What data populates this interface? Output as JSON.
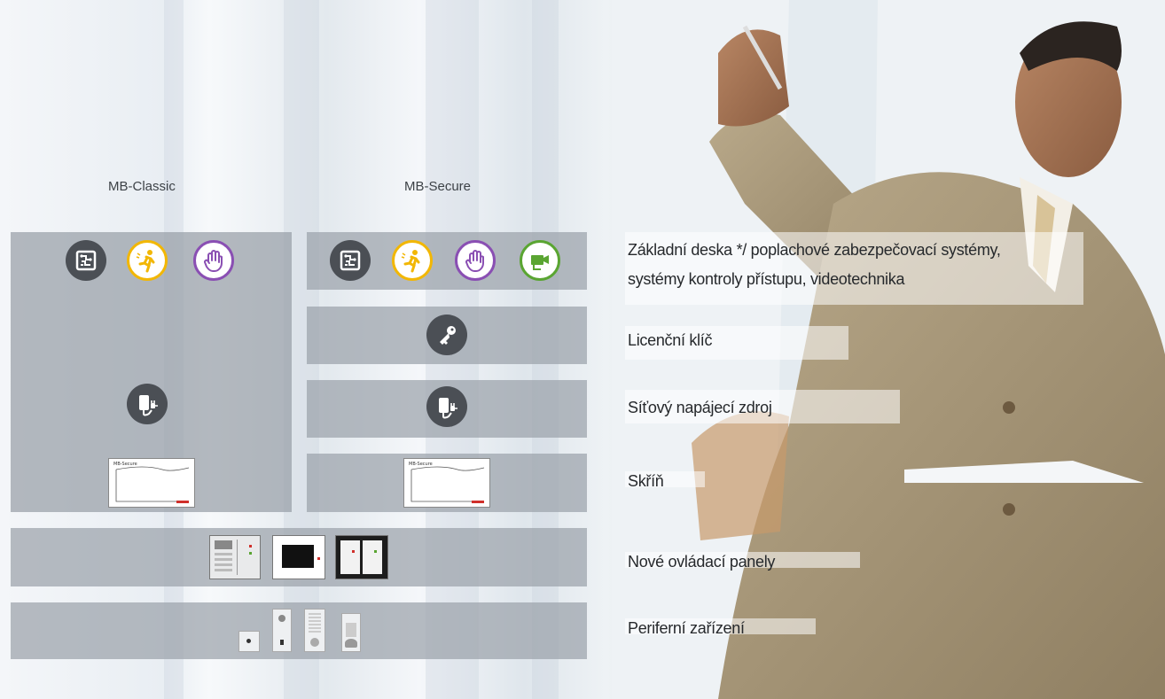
{
  "columns": {
    "classic": "MB-Classic",
    "secure": "MB-Secure"
  },
  "labels": {
    "baseboard_line1": "Základní deska */ poplachové zabezpečovací systémy,",
    "baseboard_line2": "systémy kontroly přístupu, videotechnika",
    "license_key": "Licenční klíč",
    "power_supply": "Síťový napájecí zdroj",
    "cabinet": "Skříň",
    "control_panels": "Nové ovládací panely",
    "peripherals": "Periferní zařízení"
  },
  "icons": {
    "baseboard": "circuit-board-icon",
    "intrusion": "running-person-icon",
    "access": "hand-icon",
    "video": "camera-icon",
    "license": "key-icon",
    "power": "power-plug-icon"
  },
  "colors": {
    "panel_gray": "#9ba2aa",
    "icon_dark": "#4b4f55",
    "intrusion_yellow": "#f2b705",
    "access_purple": "#8a4fb3",
    "video_green": "#5aa532",
    "brand_red": "#d0302b"
  },
  "cabinet_label": "MB-Secure"
}
